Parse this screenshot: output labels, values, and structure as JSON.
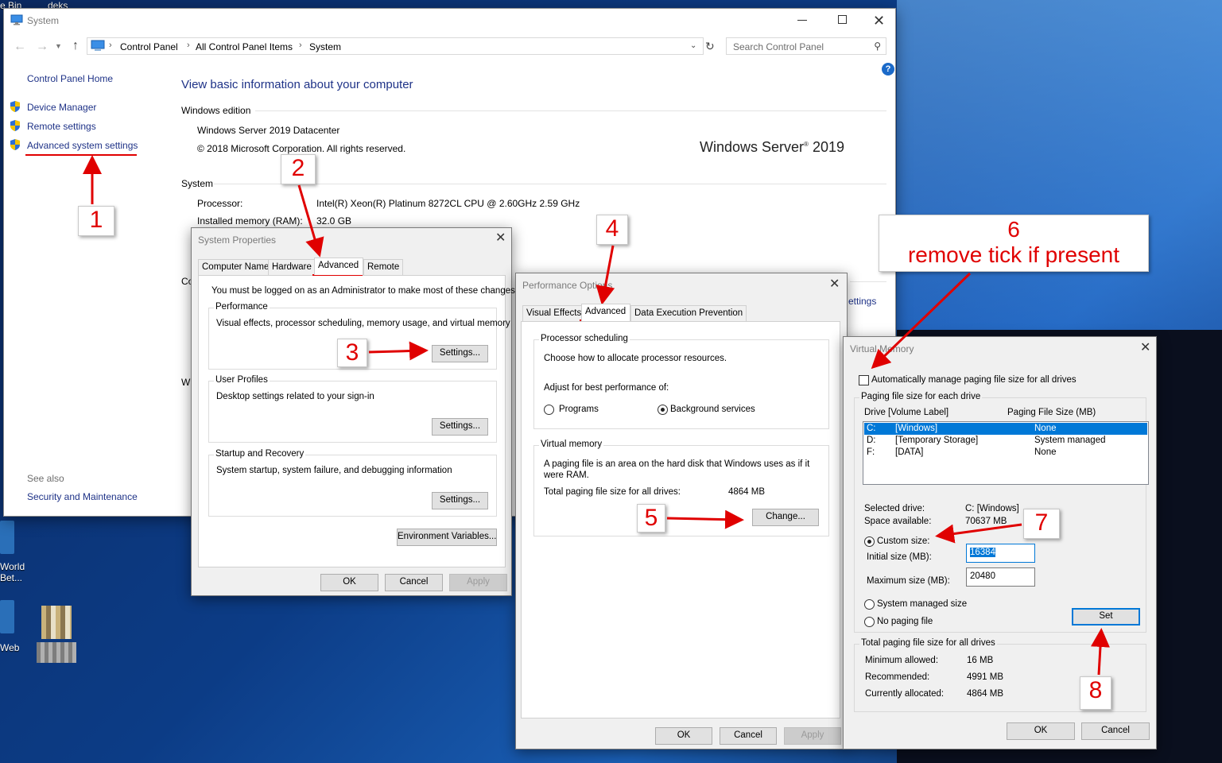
{
  "desktop": {
    "top_labels": [
      "e Bin",
      "deks"
    ],
    "icons": [
      "World Bet...",
      "Web"
    ]
  },
  "system_window": {
    "title": "System",
    "breadcrumb": [
      "Control Panel",
      "All Control Panel Items",
      "System"
    ],
    "search_placeholder": "Search Control Panel",
    "help": "?",
    "nav_home": "Control Panel Home",
    "nav_items": [
      "Device Manager",
      "Remote settings",
      "Advanced system settings"
    ],
    "see_also": "See also",
    "security": "Security and Maintenance",
    "heading": "View basic information about your computer",
    "edition_title": "Windows edition",
    "edition_name": "Windows Server 2019 Datacenter",
    "copyright": "© 2018 Microsoft Corporation. All rights reserved.",
    "logo_text": "Windows Server",
    "logo_year": " 2019",
    "system_title": "System",
    "processor_label": "Processor:",
    "processor_value": "Intel(R) Xeon(R) Platinum 8272CL CPU @ 2.60GHz   2.59 GHz",
    "memory_label": "Installed memory (RAM):",
    "memory_value": "32.0 GB",
    "partial_co": "Co",
    "partial_wi": "Wi",
    "partial_settings": "ettings"
  },
  "system_properties": {
    "title": "System Properties",
    "tabs": [
      "Computer Name",
      "Hardware",
      "Advanced",
      "Remote"
    ],
    "admin_note": "You must be logged on as an Administrator to make most of these changes.",
    "performance_title": "Performance",
    "performance_desc": "Visual effects, processor scheduling, memory usage, and virtual memory",
    "profiles_title": "User Profiles",
    "profiles_desc": "Desktop settings related to your sign-in",
    "startup_title": "Startup and Recovery",
    "startup_desc": "System startup, system failure, and debugging information",
    "settings_btn": "Settings...",
    "env_btn": "Environment Variables...",
    "ok": "OK",
    "cancel": "Cancel",
    "apply": "Apply"
  },
  "performance_options": {
    "title": "Performance Options",
    "tabs": [
      "Visual Effects",
      "Advanced",
      "Data Execution Prevention"
    ],
    "sched_title": "Processor scheduling",
    "sched_desc": "Choose how to allocate processor resources.",
    "adjust": "Adjust for best performance of:",
    "programs": "Programs",
    "background": "Background services",
    "vm_title": "Virtual memory",
    "vm_desc": "A paging file is an area on the hard disk that Windows uses as if it were RAM.",
    "total_label": "Total paging file size for all drives:",
    "total_value": "4864 MB",
    "change_btn": "Change...",
    "ok": "OK",
    "cancel": "Cancel",
    "apply": "Apply"
  },
  "virtual_memory": {
    "title": "Virtual Memory",
    "auto_manage": "Automatically manage paging file size for all drives",
    "group_title": "Paging file size for each drive",
    "col_drive": "Drive  [Volume Label]",
    "col_size": "Paging File Size (MB)",
    "drives": [
      {
        "drive": "C:",
        "label": "[Windows]",
        "size": "None"
      },
      {
        "drive": "D:",
        "label": "[Temporary Storage]",
        "size": "System managed"
      },
      {
        "drive": "F:",
        "label": "[DATA]",
        "size": "None"
      }
    ],
    "selected_label": "Selected drive:",
    "selected_value": "C:  [Windows]",
    "space_label": "Space available:",
    "space_value": "70637 MB",
    "custom": "Custom size:",
    "initial_label": "Initial size (MB):",
    "initial_value": "16384",
    "max_label": "Maximum size (MB):",
    "max_value": "20480",
    "system_managed": "System managed size",
    "no_paging": "No paging file",
    "set_btn": "Set",
    "totals_title": "Total paging file size for all drives",
    "min_label": "Minimum allowed:",
    "min_value": "16 MB",
    "rec_label": "Recommended:",
    "rec_value": "4991 MB",
    "cur_label": "Currently allocated:",
    "cur_value": "4864 MB",
    "ok": "OK",
    "cancel": "Cancel"
  },
  "annotations": {
    "n1": "1",
    "n2": "2",
    "n3": "3",
    "n4": "4",
    "n5": "5",
    "n6": "6",
    "n6_text": "remove tick if present",
    "n7": "7",
    "n8": "8"
  }
}
